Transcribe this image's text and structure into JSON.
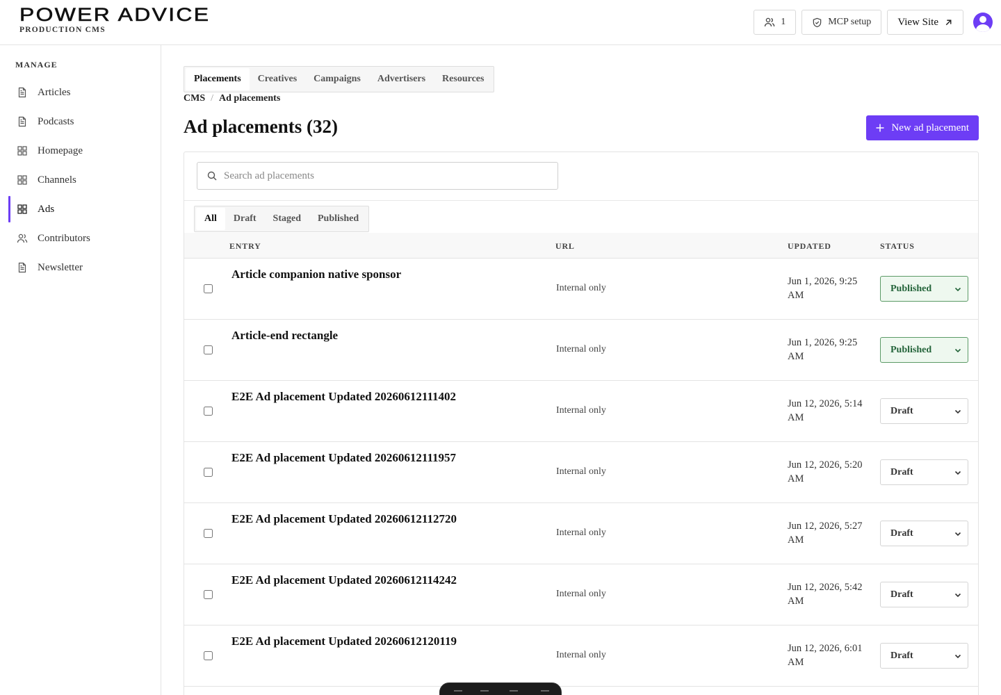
{
  "header": {
    "logo_text": "POWER ADVICE",
    "logo_sub": "PRODUCTION CMS",
    "users_count": "1",
    "mcp_label": "MCP setup",
    "view_site_label": "View Site"
  },
  "sidebar": {
    "heading": "MANAGE",
    "items": [
      {
        "label": "Articles",
        "icon": "document-icon"
      },
      {
        "label": "Podcasts",
        "icon": "document-icon"
      },
      {
        "label": "Homepage",
        "icon": "grid-icon"
      },
      {
        "label": "Channels",
        "icon": "grid-icon"
      },
      {
        "label": "Ads",
        "icon": "grid-icon",
        "active": true
      },
      {
        "label": "Contributors",
        "icon": "users-icon"
      },
      {
        "label": "Newsletter",
        "icon": "document-icon"
      }
    ]
  },
  "tabs": [
    "Placements",
    "Creatives",
    "Campaigns",
    "Advertisers",
    "Resources"
  ],
  "active_tab": "Placements",
  "breadcrumb": [
    "CMS",
    "Ad placements"
  ],
  "page_title": "Ad placements (32)",
  "new_button_label": "New ad placement",
  "search": {
    "placeholder": "Search ad placements",
    "value": ""
  },
  "filters": [
    "All",
    "Draft",
    "Staged",
    "Published"
  ],
  "active_filter": "All",
  "table": {
    "columns": [
      "ENTRY",
      "URL",
      "UPDATED",
      "STATUS"
    ],
    "rows": [
      {
        "entry": "Article companion native sponsor",
        "url": "Internal only",
        "updated": "Jun 1, 2026, 9:25 AM",
        "status": "Published"
      },
      {
        "entry": "Article-end rectangle",
        "url": "Internal only",
        "updated": "Jun 1, 2026, 9:25 AM",
        "status": "Published"
      },
      {
        "entry": "E2E Ad placement Updated 20260612111402",
        "url": "Internal only",
        "updated": "Jun 12, 2026, 5:14 AM",
        "status": "Draft"
      },
      {
        "entry": "E2E Ad placement Updated 20260612111957",
        "url": "Internal only",
        "updated": "Jun 12, 2026, 5:20 AM",
        "status": "Draft"
      },
      {
        "entry": "E2E Ad placement Updated 20260612112720",
        "url": "Internal only",
        "updated": "Jun 12, 2026, 5:27 AM",
        "status": "Draft"
      },
      {
        "entry": "E2E Ad placement Updated 20260612114242",
        "url": "Internal only",
        "updated": "Jun 12, 2026, 5:42 AM",
        "status": "Draft"
      },
      {
        "entry": "E2E Ad placement Updated 20260612120119",
        "url": "Internal only",
        "updated": "Jun 12, 2026, 6:01 AM",
        "status": "Draft"
      }
    ]
  },
  "colors": {
    "accent": "#6d3df5",
    "published_bg": "#eef8ef",
    "published_text": "#24643a"
  }
}
